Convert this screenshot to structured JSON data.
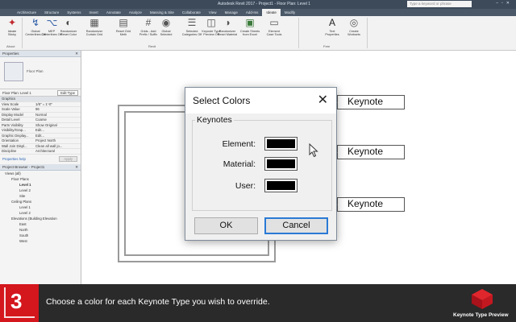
{
  "window": {
    "title": "Autodesk Revit 2017 -  Project1 - Floor Plan: Level 1",
    "search_placeholder": "Type a keyword or phrase"
  },
  "ribbon_tabs": [
    "Architecture",
    "Structure",
    "Systems",
    "Insert",
    "Annotate",
    "Analyze",
    "Massing & Site",
    "Collaborate",
    "View",
    "Manage",
    "Add-Ins",
    "Ideate",
    "Modify"
  ],
  "active_tab_index": 11,
  "ribbon": {
    "buttons": [
      {
        "label": "Ideate\nSticky",
        "icon": "ideate-sticky-icon"
      },
      {
        "label": "Global\nCenterlines Off",
        "icon": "centerlines-icon"
      },
      {
        "label": "MEP\nCenterlines Off",
        "icon": "mep-centerlines-icon"
      },
      {
        "label": "Randomizer\nReset Color",
        "icon": "reset-color-icon"
      },
      {
        "label": "Randomizer\nCurtain Grid",
        "icon": "curtain-grid-icon"
      },
      {
        "label": "Reset Grid\nMeth",
        "icon": "reset-grid-icon"
      },
      {
        "label": "Grids - Add\nPrefix / Suffix",
        "icon": "grids-prefix-icon"
      },
      {
        "label": "Global\nSelected",
        "icon": "global-selected-icon"
      },
      {
        "label": "Selected\nCategories Off",
        "icon": "categories-off-icon"
      },
      {
        "label": "Keynote Type\nPreview Off",
        "icon": "keynote-preview-icon"
      },
      {
        "label": "Randomizer\nReset Material",
        "icon": "reset-material-icon"
      },
      {
        "label": "Create Sheets\nfrom Excel",
        "icon": "create-sheets-icon"
      },
      {
        "label": "Element\nCase Tools",
        "icon": "element-case-icon"
      },
      {
        "label": "Text\nProperties",
        "icon": "text-properties-icon"
      },
      {
        "label": "Create\nWorksets",
        "icon": "worksets-icon"
      }
    ],
    "groups": [
      "About",
      "Revit",
      "Free"
    ]
  },
  "properties_panel": {
    "header": "Properties",
    "type_name": "Floor Plan",
    "instance_label": "Floor Plan: Level 1",
    "edit_type_label": "Edit Type",
    "rows": [
      {
        "k": "Graphics",
        "v": "",
        "section": true
      },
      {
        "k": "View Scale",
        "v": "1/8\" = 1'-0\""
      },
      {
        "k": "Scale Value",
        "v": "96"
      },
      {
        "k": "Display Model",
        "v": "Normal"
      },
      {
        "k": "Detail Level",
        "v": "Coarse"
      },
      {
        "k": "Parts Visibility",
        "v": "Show Original"
      },
      {
        "k": "Visibility/Grap...",
        "v": "Edit..."
      },
      {
        "k": "Graphic Display...",
        "v": "Edit..."
      },
      {
        "k": "Orientation",
        "v": "Project North"
      },
      {
        "k": "Wall Join Displ...",
        "v": "Clean all wall jo..."
      },
      {
        "k": "Discipline",
        "v": "Architectural"
      }
    ],
    "help_link": "Properties help",
    "apply_label": "Apply"
  },
  "project_browser": {
    "header": "Project Browser - Project1",
    "items": [
      {
        "t": "Views (all)",
        "lvl": 1
      },
      {
        "t": "Floor Plans",
        "lvl": 2
      },
      {
        "t": "Level 1",
        "lvl": 3,
        "bold": true
      },
      {
        "t": "Level 2",
        "lvl": 3
      },
      {
        "t": "Site",
        "lvl": 3
      },
      {
        "t": "Ceiling Plans",
        "lvl": 2
      },
      {
        "t": "Level 1",
        "lvl": 3
      },
      {
        "t": "Level 2",
        "lvl": 3
      },
      {
        "t": "Elevations (Building Elevation",
        "lvl": 2
      },
      {
        "t": "East",
        "lvl": 3
      },
      {
        "t": "North",
        "lvl": 3
      },
      {
        "t": "South",
        "lvl": 3
      },
      {
        "t": "West",
        "lvl": 3
      }
    ]
  },
  "canvas": {
    "keynote_tags": [
      "Keynote",
      "Keynote",
      "Keynote"
    ]
  },
  "dialog": {
    "title": "Select Colors",
    "close_glyph": "✕",
    "group_label": "Keynotes",
    "rows": [
      {
        "label": "Element:",
        "color": "#000000"
      },
      {
        "label": "Material:",
        "color": "#000000"
      },
      {
        "label": "User:",
        "color": "#000000"
      }
    ],
    "ok_label": "OK",
    "cancel_label": "Cancel"
  },
  "caption": {
    "step_number": "3",
    "text": "Choose a color for each Keynote Type you wish to override.",
    "brand": "Keynote Type Preview"
  },
  "colors": {
    "accent": "#d4161d",
    "dialog_focus": "#2a7ad5",
    "swatch": "#000000"
  }
}
